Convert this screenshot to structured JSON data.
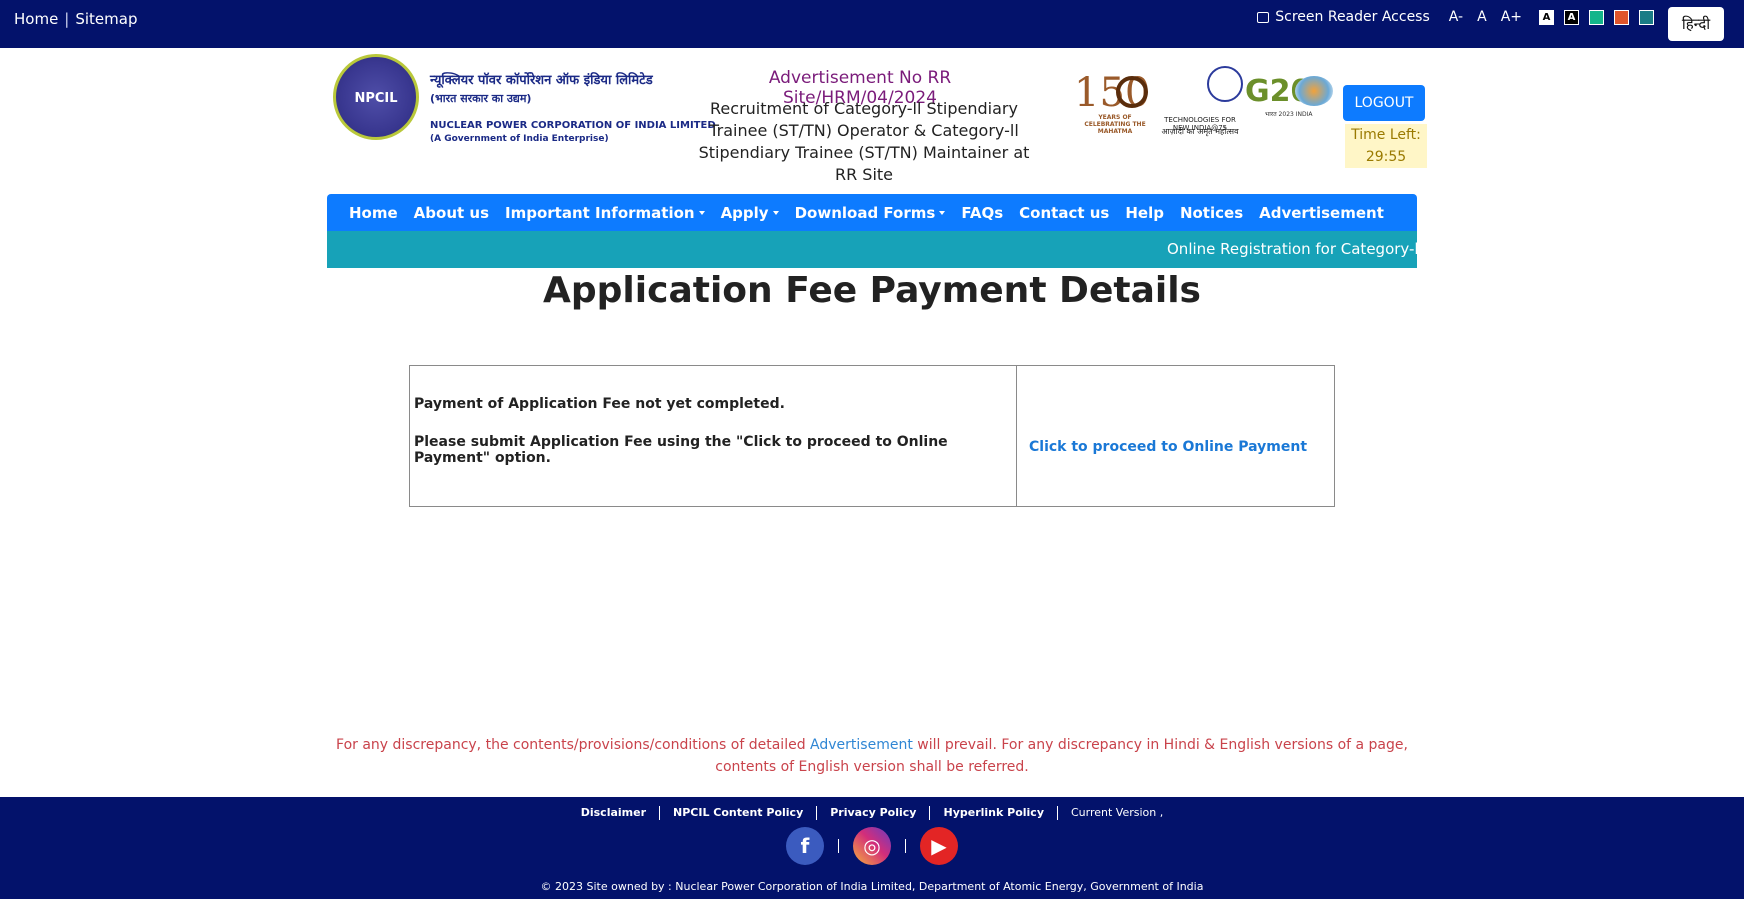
{
  "topbar": {
    "home": "Home",
    "sitemap": "Sitemap",
    "screen_reader": "Screen Reader Access",
    "font_minus": "A-",
    "font_normal": "A",
    "font_plus": "A+",
    "contrast_white": "A",
    "contrast_black": "A",
    "language": "हिन्दी"
  },
  "header": {
    "logo_text": "NPCIL",
    "org_hindi": "न्यूक्लियर पॉवर कॉर्पोरेशन ऑफ इंडिया लिमिटेड",
    "org_hindi_sub": "(भारत सरकार का उद्यम)",
    "org_english": "NUCLEAR POWER CORPORATION OF INDIA LIMITED",
    "org_english_sub": "(A Government of India Enterprise)",
    "advertisement_no": "Advertisement No RR Site/HRM/04/2024",
    "recruitment_title": "Recruitment of Category-ll Stipendiary Trainee (ST/TN) Operator & Category-ll Stipendiary Trainee (ST/TN) Maintainer at RR Site",
    "logo_150_num": "150",
    "logo_150_caption": "YEARS OF CELEBRATING THE MAHATMA",
    "logo_india75_caption": "TECHNOLOGIES FOR NEW INDIA@75",
    "logo_india75_hindi": "आज़ादी का अमृत महोत्सव",
    "logo_g20": "G20",
    "logo_g20_caption": "भारत 2023 INDIA",
    "logout": "LOGOUT",
    "time_left_label": "Time Left:",
    "time_left_value": "29:55"
  },
  "nav": {
    "home": "Home",
    "about": "About us",
    "important": "Important Information",
    "apply": "Apply",
    "download": "Download Forms",
    "faqs": "FAQs",
    "contact": "Contact us",
    "help": "Help",
    "notices": "Notices",
    "advertisement": "Advertisement"
  },
  "marquee": {
    "text": "Online Registration for Category-ll Stip"
  },
  "main": {
    "title": "Application Fee Payment Details",
    "msg1": "Payment of Application Fee not yet completed.",
    "msg2": "Please submit Application Fee using the \"Click to proceed to Online Payment\" option.",
    "payment_link": "Click to proceed to Online Payment"
  },
  "disclaimer": {
    "part1": "For any discrepancy, the contents/provisions/conditions of detailed ",
    "link": "Advertisement",
    "part2": " will prevail. For any discrepancy in Hindi & English versions of a page, contents of English version shall be referred."
  },
  "footer": {
    "disclaimer": "Disclaimer",
    "content_policy": "NPCIL Content Policy",
    "privacy": "Privacy Policy",
    "hyperlink": "Hyperlink Policy",
    "version": "Current Version ,",
    "facebook": "f",
    "instagram": "◎",
    "youtube": "▶",
    "copyright": "© 2023 Site owned by : Nuclear Power Corporation of India Limited, Department of Atomic Energy, Government of India"
  },
  "colors": {
    "topbar_bg": "#03126b",
    "nav_bg": "#0d7bff",
    "marquee_bg": "#17a2b8",
    "link": "#1a78d6",
    "disclaimer_text": "#c9434b"
  }
}
